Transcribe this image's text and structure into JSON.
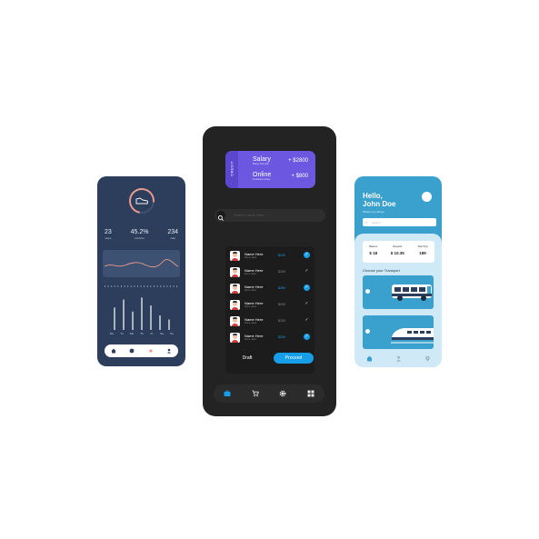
{
  "colors": {
    "left_bg": "#2c3e5b",
    "middle_bg": "#232323",
    "card_purple": "#6c58e0",
    "accent_blue": "#179ee8",
    "right_accent": "#3aa0cd",
    "ring_color": "#e89a8d"
  },
  "fitness": {
    "ring_icon": "sneaker-icon",
    "stats": [
      {
        "value": "23",
        "label": "steps"
      },
      {
        "value": "45.2%",
        "label": "workout"
      },
      {
        "value": "234",
        "label": "cals"
      }
    ],
    "bar_levels": [
      0.55,
      0.75,
      0.45,
      0.8,
      0.6,
      0.35,
      0.25
    ],
    "days": [
      "Mo",
      "Tu",
      "We",
      "Th",
      "Fr",
      "Sa",
      "Su"
    ],
    "nav_icons": [
      "home-icon",
      "circle-icon",
      "heart-icon",
      "user-icon"
    ]
  },
  "wallet": {
    "card_tag": "CREDIT",
    "card_rows": [
      {
        "title": "Salary",
        "subtitle": "Money from job",
        "amount": "+ $2800"
      },
      {
        "title": "Online",
        "subtitle": "Freelance money",
        "amount": "+ $800"
      }
    ],
    "search_placeholder": "Search name Here",
    "transactions": [
      {
        "name": "Name Here",
        "sub": "Since name",
        "amount": "$240",
        "checked": true
      },
      {
        "name": "Name Here",
        "sub": "Since name",
        "amount": "$200",
        "checked": false
      },
      {
        "name": "Name Here",
        "sub": "Since name",
        "amount": "$250",
        "checked": true
      },
      {
        "name": "Name Here",
        "sub": "Since name",
        "amount": "$200",
        "checked": false
      },
      {
        "name": "Name Here",
        "sub": "Since name",
        "amount": "$200",
        "checked": false
      },
      {
        "name": "Name Here",
        "sub": "Since name",
        "amount": "$200",
        "checked": true
      }
    ],
    "draft_label": "Draft",
    "proceed_label": "Proceed",
    "nav_icons": [
      "wallet-icon",
      "cart-icon",
      "gear-icon",
      "grid-icon"
    ]
  },
  "transport": {
    "greeting": "Hello,",
    "name": "John Doe",
    "sub": "Where you will go",
    "search_placeholder": "Search",
    "stats": [
      {
        "label": "Balance",
        "value": "$ 18"
      },
      {
        "label": "Rewards",
        "value": "$ 10.35"
      },
      {
        "label": "Total Trips",
        "value": "189"
      }
    ],
    "choose_label": "Choose your Transport",
    "options": [
      "bus-icon",
      "train-icon"
    ],
    "nav_icons": [
      "home-icon",
      "user-icon",
      "location-pin-icon"
    ]
  }
}
